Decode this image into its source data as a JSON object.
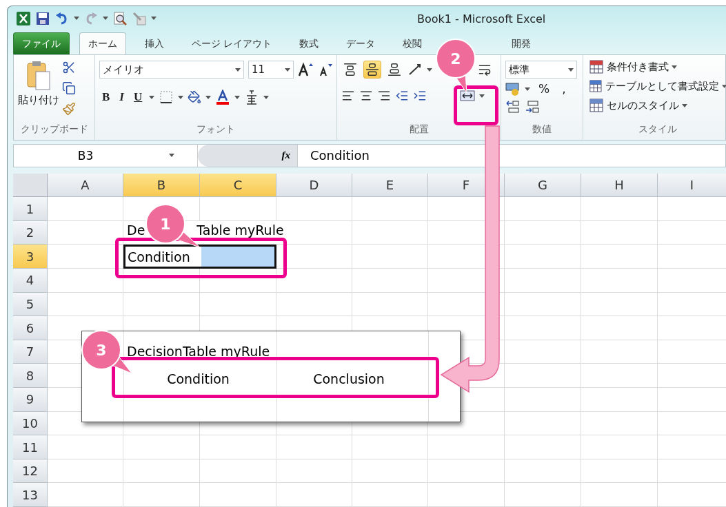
{
  "window": {
    "title": "Book1  -  Microsoft Excel"
  },
  "tabs": [
    {
      "label": "ファイル",
      "kind": "file",
      "selected": false
    },
    {
      "label": "ホーム",
      "kind": "tab",
      "selected": true
    },
    {
      "label": "挿入",
      "kind": "tab",
      "selected": false
    },
    {
      "label": "ページ レイアウト",
      "kind": "tab",
      "selected": false
    },
    {
      "label": "数式",
      "kind": "tab",
      "selected": false
    },
    {
      "label": "データ",
      "kind": "tab",
      "selected": false
    },
    {
      "label": "校閲",
      "kind": "tab",
      "selected": false
    },
    {
      "label": "開発",
      "kind": "tab",
      "selected": false
    }
  ],
  "ribbon": {
    "clipboard": {
      "paste_label": "貼り付け",
      "group_label": "クリップボード"
    },
    "font": {
      "name": "メイリオ",
      "size": "11",
      "style_buttons": [
        "B",
        "I",
        "U"
      ],
      "group_label": "フォント"
    },
    "alignment": {
      "vertical": [
        {
          "selected": false
        },
        {
          "selected": true
        },
        {
          "selected": false
        }
      ],
      "group_label": "配置"
    },
    "number": {
      "format": "標準",
      "percent": "%",
      "comma": ",",
      "group_label": "数値"
    },
    "styles": {
      "items": [
        "条件付き書式",
        "テーブルとして書式設定",
        "セルのスタイル"
      ],
      "group_label": "スタイル"
    }
  },
  "formula_bar": {
    "name_box": "B3",
    "function_label": "fx",
    "value": "Condition"
  },
  "grid": {
    "columns": [
      {
        "label": "A",
        "selected": false
      },
      {
        "label": "B",
        "selected": true
      },
      {
        "label": "C",
        "selected": true
      },
      {
        "label": "D",
        "selected": false
      },
      {
        "label": "E",
        "selected": false
      },
      {
        "label": "F",
        "selected": false
      },
      {
        "label": "G",
        "selected": false
      },
      {
        "label": "H",
        "selected": false
      },
      {
        "label": "I",
        "selected": false
      }
    ],
    "rows": [
      {
        "label": "1",
        "selected": false
      },
      {
        "label": "2",
        "selected": false
      },
      {
        "label": "3",
        "selected": true
      },
      {
        "label": "4",
        "selected": false
      },
      {
        "label": "5",
        "selected": false
      },
      {
        "label": "6",
        "selected": false
      },
      {
        "label": "7",
        "selected": false
      },
      {
        "label": "8",
        "selected": false
      },
      {
        "label": "9",
        "selected": false
      },
      {
        "label": "10",
        "selected": false
      },
      {
        "label": "11",
        "selected": false
      },
      {
        "label": "12",
        "selected": false
      },
      {
        "label": "13",
        "selected": false
      }
    ],
    "b2_visible_parts": [
      "De",
      "Table myRule"
    ],
    "b3": "Condition"
  },
  "preview": {
    "title": "DecisionTable myRule",
    "headers": [
      "Condition",
      "Conclusion"
    ]
  },
  "callouts": [
    "1",
    "2",
    "3"
  ]
}
